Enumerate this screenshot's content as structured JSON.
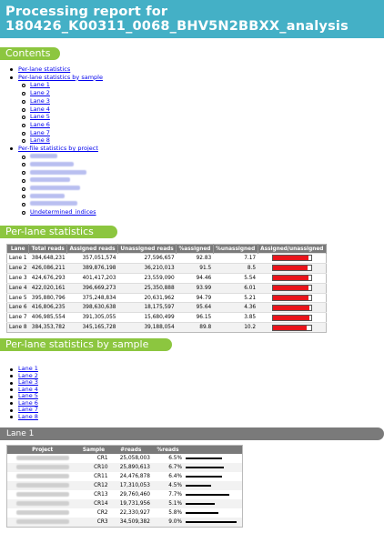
{
  "report": {
    "title_line1": "Processing report for",
    "title_line2": "180426_K00311_0068_BHV5N2BBXX_analysis"
  },
  "contents": {
    "heading": "Contents",
    "items": [
      {
        "label": "Per-lane statistics"
      },
      {
        "label": "Per-lane statistics by sample",
        "children": [
          "Lane 1",
          "Lane 2",
          "Lane 3",
          "Lane 4",
          "Lane 5",
          "Lane 6",
          "Lane 7",
          "Lane 8"
        ]
      },
      {
        "label": "Per-file statistics by project",
        "children": [
          "",
          "",
          "",
          "",
          "",
          "",
          "",
          "Undetermined_indices"
        ]
      }
    ]
  },
  "per_lane": {
    "heading": "Per-lane statistics",
    "columns": [
      "Lane",
      "Total reads",
      "Assigned reads",
      "Unassigned reads",
      "%assigned",
      "%unassigned",
      "Assigned/unassigned"
    ],
    "rows": [
      {
        "lane": "Lane 1",
        "total": "384,648,231",
        "assigned": "357,051,574",
        "unassigned": "27,596,657",
        "pa": "92.83",
        "pu": "7.17",
        "frac": 0.9283
      },
      {
        "lane": "Lane 2",
        "total": "426,086,211",
        "assigned": "389,876,198",
        "unassigned": "36,210,013",
        "pa": "91.5",
        "pu": "8.5",
        "frac": 0.915
      },
      {
        "lane": "Lane 3",
        "total": "424,676,293",
        "assigned": "401,417,203",
        "unassigned": "23,559,090",
        "pa": "94.46",
        "pu": "5.54",
        "frac": 0.9446
      },
      {
        "lane": "Lane 4",
        "total": "422,020,161",
        "assigned": "396,669,273",
        "unassigned": "25,350,888",
        "pa": "93.99",
        "pu": "6.01",
        "frac": 0.9399
      },
      {
        "lane": "Lane 5",
        "total": "395,880,796",
        "assigned": "375,248,834",
        "unassigned": "20,631,962",
        "pa": "94.79",
        "pu": "5.21",
        "frac": 0.9479
      },
      {
        "lane": "Lane 6",
        "total": "416,806,235",
        "assigned": "398,630,638",
        "unassigned": "18,175,597",
        "pa": "95.64",
        "pu": "4.36",
        "frac": 0.9564
      },
      {
        "lane": "Lane 7",
        "total": "406,985,554",
        "assigned": "391,305,055",
        "unassigned": "15,680,499",
        "pa": "96.15",
        "pu": "3.85",
        "frac": 0.9615
      },
      {
        "lane": "Lane 8",
        "total": "384,353,782",
        "assigned": "345,165,728",
        "unassigned": "39,188,054",
        "pa": "89.8",
        "pu": "10.2",
        "frac": 0.898
      }
    ]
  },
  "by_sample": {
    "heading": "Per-lane statistics by sample",
    "links": [
      "Lane 1",
      "Lane 2",
      "Lane 3",
      "Lane 4",
      "Lane 5",
      "Lane 6",
      "Lane 7",
      "Lane 8"
    ]
  },
  "lane1": {
    "heading": "Lane 1",
    "columns": [
      "Project",
      "Sample",
      "#reads",
      "%reads"
    ],
    "rows": [
      {
        "sample": "CR1",
        "reads": "25,058,003",
        "pct": "6.5%",
        "frac": 0.065
      },
      {
        "sample": "CR10",
        "reads": "25,890,613",
        "pct": "6.7%",
        "frac": 0.067
      },
      {
        "sample": "CR11",
        "reads": "24,476,878",
        "pct": "6.4%",
        "frac": 0.064
      },
      {
        "sample": "CR12",
        "reads": "17,310,053",
        "pct": "4.5%",
        "frac": 0.045
      },
      {
        "sample": "CR13",
        "reads": "29,760,460",
        "pct": "7.7%",
        "frac": 0.077
      },
      {
        "sample": "CR14",
        "reads": "19,731,956",
        "pct": "5.1%",
        "frac": 0.051
      },
      {
        "sample": "CR2",
        "reads": "22,330,927",
        "pct": "5.8%",
        "frac": 0.058
      },
      {
        "sample": "CR3",
        "reads": "34,509,382",
        "pct": "9.0%",
        "frac": 0.09
      }
    ]
  },
  "colors": {
    "title": "#44b0c6",
    "section": "#8cc63f",
    "bar": "#e8141b",
    "header": "#7a7a7a"
  }
}
